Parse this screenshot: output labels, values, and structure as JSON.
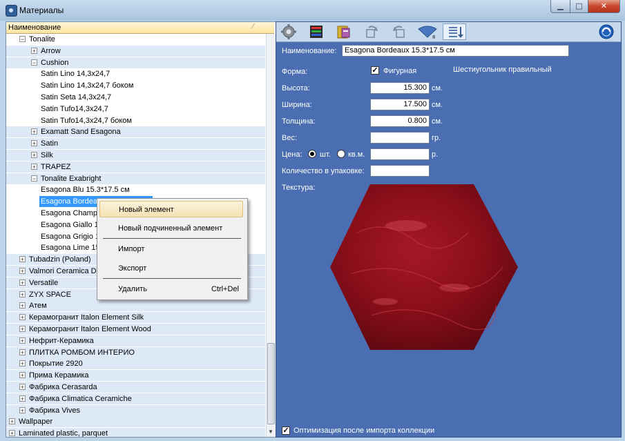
{
  "window": {
    "title": "Материалы"
  },
  "tree": {
    "column_header": "Наименование",
    "sort_glyph": "⁄",
    "rows": [
      {
        "label": "Tonalite",
        "level": 1,
        "exp": "−",
        "alt": false
      },
      {
        "label": "Arrow",
        "level": 2,
        "exp": "+",
        "alt": true
      },
      {
        "label": "Cushion",
        "level": 2,
        "exp": "−",
        "alt": true
      },
      {
        "label": "Satin Lino 14,3x24,7",
        "level": 3,
        "exp": "",
        "alt": false
      },
      {
        "label": "Satin Lino 14,3x24,7 боком",
        "level": 3,
        "exp": "",
        "alt": false
      },
      {
        "label": "Satin Seta 14,3x24,7",
        "level": 3,
        "exp": "",
        "alt": false
      },
      {
        "label": "Satin Tufo14,3x24,7",
        "level": 3,
        "exp": "",
        "alt": false
      },
      {
        "label": "Satin Tufo14,3x24,7 боком",
        "level": 3,
        "exp": "",
        "alt": false
      },
      {
        "label": "Examatt Sand Esagona",
        "level": 2,
        "exp": "+",
        "alt": true
      },
      {
        "label": "Satin",
        "level": 2,
        "exp": "+",
        "alt": true
      },
      {
        "label": "Silk",
        "level": 2,
        "exp": "+",
        "alt": true
      },
      {
        "label": "TRAPEZ",
        "level": 2,
        "exp": "+",
        "alt": true
      },
      {
        "label": "Tonalite Exabright",
        "level": 2,
        "exp": "−",
        "alt": true
      },
      {
        "label": "Esagona Blu 15.3*17.5 см",
        "level": 3,
        "exp": "",
        "alt": false
      },
      {
        "label": "Esagona Bordeaux 15.3*17.5 см",
        "level": 3,
        "exp": "",
        "alt": false,
        "selected": true
      },
      {
        "label": "Esagona Champagne 15.3*17.5 см",
        "level": 3,
        "exp": "",
        "alt": false
      },
      {
        "label": "Esagona Giallo 15.3*17.5 см",
        "level": 3,
        "exp": "",
        "alt": false
      },
      {
        "label": "Esagona Grigio 15.3*17.5 см",
        "level": 3,
        "exp": "",
        "alt": false
      },
      {
        "label": "Esagona Lime 15.3*17.5 см",
        "level": 3,
        "exp": "",
        "alt": false
      },
      {
        "label": "Tubadzin (Poland)",
        "level": 1,
        "exp": "+",
        "alt": true
      },
      {
        "label": "Valmori Ceramica Design",
        "level": 1,
        "exp": "+",
        "alt": true
      },
      {
        "label": "Versatile",
        "level": 1,
        "exp": "+",
        "alt": true
      },
      {
        "label": "ZYX SPACE",
        "level": 1,
        "exp": "+",
        "alt": true
      },
      {
        "label": "Атем",
        "level": 1,
        "exp": "+",
        "alt": true
      },
      {
        "label": "Керамогранит Italon Element Silk",
        "level": 1,
        "exp": "+",
        "alt": true
      },
      {
        "label": "Керамогранит Italon Element Wood",
        "level": 1,
        "exp": "+",
        "alt": true
      },
      {
        "label": "Нефрит-Керамика",
        "level": 1,
        "exp": "+",
        "alt": true
      },
      {
        "label": "ПЛИТКА РОМБОМ ИНТЕРИО",
        "level": 1,
        "exp": "+",
        "alt": true
      },
      {
        "label": "Покрытие 2920",
        "level": 1,
        "exp": "+",
        "alt": true
      },
      {
        "label": "Прима Керамика",
        "level": 1,
        "exp": "+",
        "alt": true
      },
      {
        "label": "Фабрика Cerasarda",
        "level": 1,
        "exp": "+",
        "alt": true
      },
      {
        "label": "Фабрика Climatica Ceramiche",
        "level": 1,
        "exp": "+",
        "alt": true
      },
      {
        "label": "Фабрика Vives",
        "level": 1,
        "exp": "+",
        "alt": true
      },
      {
        "label": "Wallpaper",
        "level": 0,
        "exp": "+",
        "alt": true
      },
      {
        "label": "Laminated plastic, parquet",
        "level": 0,
        "exp": "+",
        "alt": true
      }
    ]
  },
  "context_menu": {
    "items": [
      {
        "label": "Новый элемент",
        "shortcut": ""
      },
      {
        "label": "Новый подчиненный элемент",
        "shortcut": ""
      },
      {
        "label": "Импорт",
        "shortcut": ""
      },
      {
        "label": "Экспорт",
        "shortcut": ""
      },
      {
        "label": "Удалить",
        "shortcut": "Ctrl+Del"
      }
    ]
  },
  "toolbar": {
    "icons": [
      "gear-icon",
      "material-stack-icon",
      "folder-books-icon",
      "rotate-right-icon",
      "rotate-left-icon",
      "fan-pattern-icon",
      "sort-down-icon",
      "globe-icon"
    ]
  },
  "form": {
    "name_label": "Наименование:",
    "name_value": "Esagona Bordeaux 15.3*17.5 см",
    "shape_label": "Форма:",
    "shaped_checkbox_label": "Фигурная",
    "shaped_checked": true,
    "shape_type": "Шестиугольник правильный",
    "height_label": "Высота:",
    "height_value": "15.300",
    "width_label": "Ширина:",
    "width_value": "17.500",
    "thickness_label": "Толщина:",
    "thickness_value": "0.800",
    "unit_cm": "см.",
    "weight_label": "Вес:",
    "weight_value": "",
    "unit_gr": "гр.",
    "price_label": "Цена:",
    "price_per_piece": "шт.",
    "price_per_sqm": "кв.м.",
    "price_value": "",
    "unit_rub": "р.",
    "pack_qty_label": "Количество в упаковке:",
    "pack_qty_value": "",
    "texture_label": "Текстура:",
    "optimize_label": "Оптимизация после импорта коллекции",
    "optimize_checked": true
  },
  "colors": {
    "panel_blue": "#4a6eb1",
    "tile_red": "#8e0f1c",
    "selection": "#3399ff"
  }
}
